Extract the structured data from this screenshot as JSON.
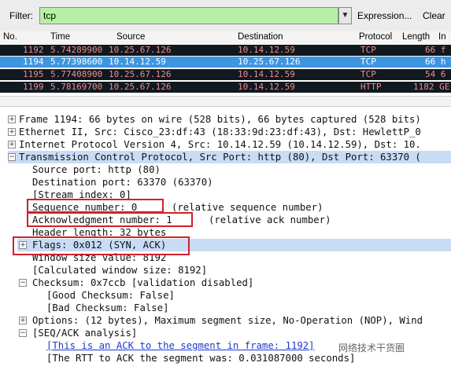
{
  "filter": {
    "label": "Filter:",
    "value": "tcp",
    "expression_label": "Expression...",
    "clear_label": "Clear"
  },
  "columns": [
    "No.",
    "Time",
    "Source",
    "Destination",
    "Protocol",
    "Length",
    "In"
  ],
  "packets": [
    {
      "no": "1192",
      "time": "5.74289900",
      "src": "10.25.67.126",
      "dst": "10.14.12.59",
      "proto": "TCP",
      "len": "66 f"
    },
    {
      "no": "1194",
      "time": "5.77398600",
      "src": "10.14.12.59",
      "dst": "10.25.67.126",
      "proto": "TCP",
      "len": "66 h"
    },
    {
      "no": "1195",
      "time": "5.77408900",
      "src": "10.25.67.126",
      "dst": "10.14.12.59",
      "proto": "TCP",
      "len": "54 6"
    },
    {
      "no": "1199",
      "time": "5.78169700",
      "src": "10.25.67.126",
      "dst": "10.14.12.59",
      "proto": "HTTP",
      "len": "1182 GE"
    }
  ],
  "details": {
    "frame": "Frame 1194: 66 bytes on wire (528 bits), 66 bytes captured (528 bits)",
    "ethernet": "Ethernet II, Src: Cisco_23:df:43 (18:33:9d:23:df:43), Dst: HewlettP_0",
    "ip": "Internet Protocol Version 4, Src: 10.14.12.59 (10.14.12.59), Dst: 10.",
    "tcp": "Transmission Control Protocol, Src Port: http (80), Dst Port: 63370 (",
    "src_port": "Source port: http (80)",
    "dst_port": "Destination port: 63370 (63370)",
    "stream_index": "[Stream index: 0]",
    "seq": "Sequence number: 0",
    "seq_note": "(relative sequence number)",
    "ack": "Acknowledgment number: 1",
    "ack_note": "(relative ack number)",
    "header_len": "Header length: 32 bytes",
    "flags": "Flags: 0x012 (SYN, ACK)",
    "window": "Window size value: 8192",
    "calc_window": "[Calculated window size: 8192]",
    "checksum": "Checksum: 0x7ccb [validation disabled]",
    "good_checksum": "[Good Checksum: False]",
    "bad_checksum": "[Bad Checksum: False]",
    "options": "Options: (12 bytes), Maximum segment size, No-Operation (NOP), Wind",
    "seqack": "[SEQ/ACK analysis]",
    "ack_link": "[This is an ACK to the segment in frame: 1192]",
    "rtt": "[The RTT to ACK the segment was: 0.031087000 seconds]"
  },
  "watermark": "网络技术干货圈",
  "colors": {
    "filter_bg": "#b7f0a5",
    "dark_row_bg": "#101820",
    "dark_row_fg": "#f08c8c",
    "selected_row_bg": "#3e96e0",
    "highlight_row_bg": "#c9dcf6",
    "annotation_red": "#d0202a"
  }
}
